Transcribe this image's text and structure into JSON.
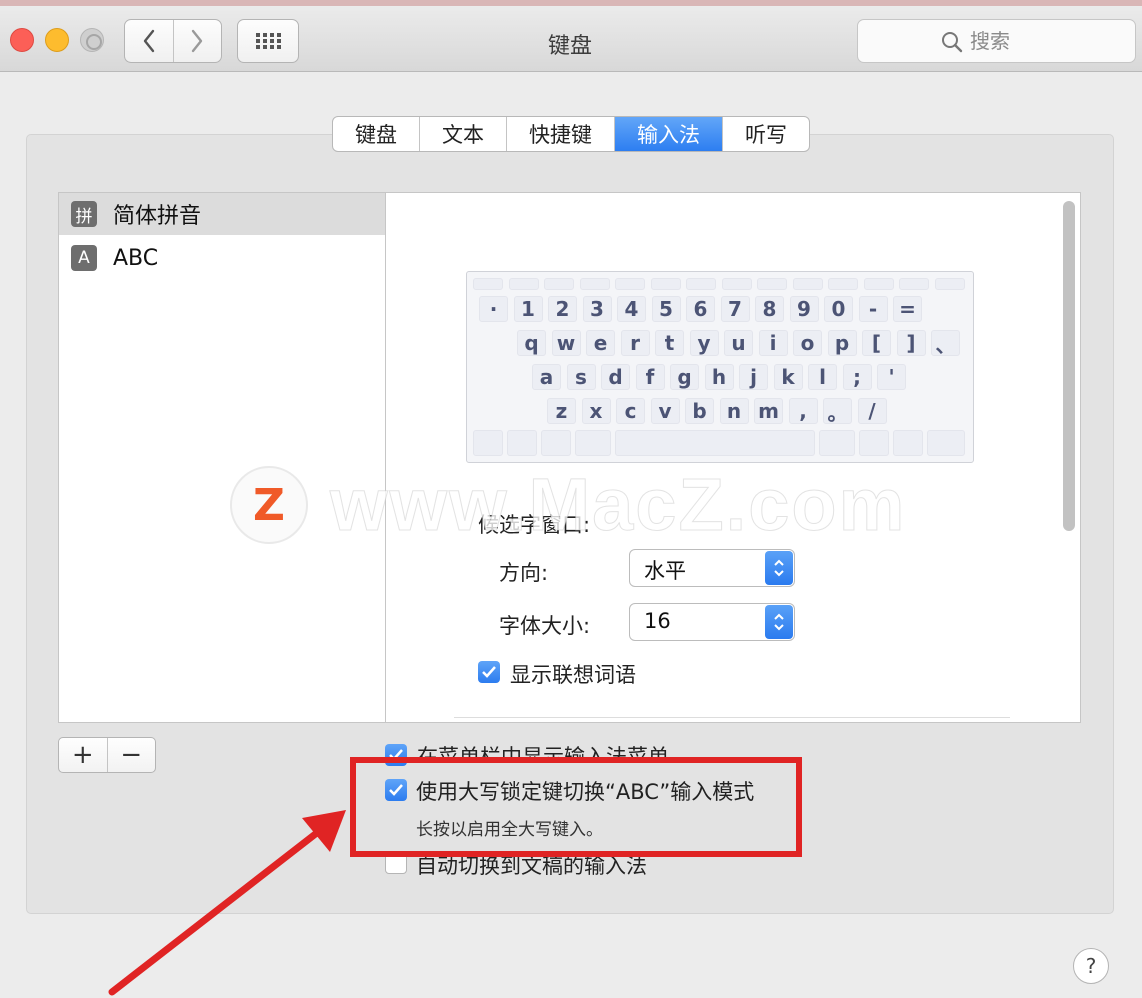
{
  "window": {
    "title": "键盘",
    "search_placeholder": "搜索"
  },
  "tabs": [
    {
      "label": "键盘",
      "active": false
    },
    {
      "label": "文本",
      "active": false
    },
    {
      "label": "快捷键",
      "active": false
    },
    {
      "label": "输入法",
      "active": true
    },
    {
      "label": "听写",
      "active": false
    }
  ],
  "input_sources": [
    {
      "icon_text": "拼",
      "icon": "pinyin-icon",
      "label": "简体拼音",
      "selected": true
    },
    {
      "icon_text": "A",
      "icon": "abc-icon",
      "label": "ABC",
      "selected": false
    }
  ],
  "keyboard_rows": [
    [
      "·",
      "1",
      "2",
      "3",
      "4",
      "5",
      "6",
      "7",
      "8",
      "9",
      "0",
      "-",
      "="
    ],
    [
      "q",
      "w",
      "e",
      "r",
      "t",
      "y",
      "u",
      "i",
      "o",
      "p",
      "[",
      "]",
      "、"
    ],
    [
      "a",
      "s",
      "d",
      "f",
      "g",
      "h",
      "j",
      "k",
      "l",
      ";",
      "'"
    ],
    [
      "z",
      "x",
      "c",
      "v",
      "b",
      "n",
      "m",
      ",",
      "。",
      "/"
    ]
  ],
  "candidate_window": {
    "heading": "候选字窗口:",
    "direction_label": "方向:",
    "direction_value": "水平",
    "font_size_label": "字体大小:",
    "font_size_value": "16",
    "show_predictions_label": "显示联想词语",
    "show_predictions_checked": true
  },
  "options": {
    "show_in_menu_bar_label": "在菜单栏中显示输入法菜单",
    "show_in_menu_bar_checked": true,
    "caps_lock_switch_label": "使用大写锁定键切换“ABC”输入模式",
    "caps_lock_switch_checked": true,
    "caps_lock_sub": "长按以启用全大写键入。",
    "auto_switch_label": "自动切换到文稿的输入法",
    "auto_switch_checked": false
  },
  "list_buttons": {
    "add": "+",
    "remove": "−"
  },
  "help_label": "?",
  "watermark": {
    "logo_text": "Z",
    "text": "www.MacZ.com"
  },
  "colors": {
    "accent": "#2d7ef1",
    "highlight": "#e02424"
  }
}
